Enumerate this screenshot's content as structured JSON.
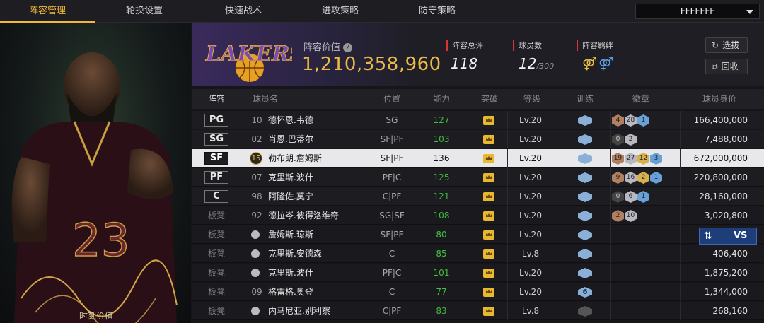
{
  "nav": {
    "tabs": [
      "阵容管理",
      "轮换设置",
      "快速战术",
      "进攻策略",
      "防守策略"
    ],
    "active_tab": 0,
    "select_value": "FFFFFFF"
  },
  "portrait": {
    "caption": "时刻价值"
  },
  "summary": {
    "value_title": "阵容价值",
    "value": "1,210,358,960",
    "stats": [
      {
        "label": "阵容总评",
        "value": "118",
        "suffix": ""
      },
      {
        "label": "球员数",
        "value": "12",
        "suffix": "/300"
      },
      {
        "label": "阵容羁绊",
        "value": "",
        "suffix": ""
      }
    ],
    "scout_button": "选拔",
    "recycle_button": "回收"
  },
  "table": {
    "headers": [
      "阵容",
      "球员名",
      "位置",
      "能力",
      "突破",
      "等级",
      "训练",
      "徽章",
      "球员身价"
    ],
    "rows": [
      {
        "slot": "PG",
        "num": "10",
        "name": "德怀恩.韦德",
        "pos": "SG",
        "ability": "127",
        "level": "Lv.20",
        "train": "",
        "badges": [
          [
            "bronze",
            "4"
          ],
          [
            "silver",
            "28"
          ],
          [
            "blue",
            "1"
          ]
        ],
        "salary": "166,400,000",
        "type": "starter"
      },
      {
        "slot": "SG",
        "num": "02",
        "name": "肖恩.巴蒂尔",
        "pos": "SF|PF",
        "ability": "103",
        "level": "Lv.20",
        "train": "",
        "badges": [
          [
            "dark",
            "0"
          ],
          [
            "silver",
            "2"
          ]
        ],
        "salary": "7,488,000",
        "type": "starter"
      },
      {
        "slot": "SF",
        "num": "15",
        "name": "勒布朗.詹姆斯",
        "pos": "SF|PF",
        "ability": "136",
        "level": "Lv.20",
        "train": "",
        "badges": [
          [
            "bronze",
            "19"
          ],
          [
            "silver",
            "27"
          ],
          [
            "gold",
            "12"
          ],
          [
            "blue",
            "3"
          ]
        ],
        "salary": "672,000,000",
        "type": "selected"
      },
      {
        "slot": "PF",
        "num": "07",
        "name": "克里斯.波什",
        "pos": "PF|C",
        "ability": "125",
        "level": "Lv.20",
        "train": "",
        "badges": [
          [
            "bronze",
            "9"
          ],
          [
            "silver",
            "16"
          ],
          [
            "gold",
            "2"
          ],
          [
            "blue",
            "1"
          ]
        ],
        "salary": "220,800,000",
        "type": "starter"
      },
      {
        "slot": "C",
        "num": "98",
        "name": "阿隆佐.莫宁",
        "pos": "C|PF",
        "ability": "121",
        "level": "Lv.20",
        "train": "",
        "badges": [
          [
            "dark",
            "0"
          ],
          [
            "silver",
            "6"
          ],
          [
            "blue",
            "1"
          ]
        ],
        "salary": "28,160,000",
        "type": "starter"
      },
      {
        "slot": "板凳",
        "num": "92",
        "name": "德拉岑.彼得洛维奇",
        "pos": "SG|SF",
        "ability": "108",
        "level": "Lv.20",
        "train": "",
        "badges": [
          [
            "bronze",
            "2"
          ],
          [
            "silver",
            "10"
          ]
        ],
        "salary": "3,020,800",
        "type": "bench"
      },
      {
        "slot": "板凳",
        "num": "",
        "name": "詹姆斯.琼斯",
        "pos": "SF|PF",
        "ability": "80",
        "level": "Lv.20",
        "train": "",
        "badges": [],
        "salary": "",
        "type": "benchbars"
      },
      {
        "slot": "板凳",
        "num": "",
        "name": "克里斯.安德森",
        "pos": "C",
        "ability": "85",
        "level": "Lv.8",
        "train": "",
        "badges": [],
        "salary": "406,400",
        "type": "benchbars"
      },
      {
        "slot": "板凳",
        "num": "",
        "name": "克里斯.波什",
        "pos": "PF|C",
        "ability": "101",
        "level": "Lv.20",
        "train": "",
        "badges": [],
        "salary": "1,875,200",
        "type": "benchbars"
      },
      {
        "slot": "板凳",
        "num": "09",
        "name": "格雷格.奥登",
        "pos": "C",
        "ability": "77",
        "level": "Lv.20",
        "train": "6",
        "badges": [],
        "salary": "1,344,000",
        "type": "bench"
      },
      {
        "slot": "板凳",
        "num": "",
        "name": "内马尼亚.别利察",
        "pos": "C|PF",
        "ability": "83",
        "level": "Lv.8",
        "train": "",
        "badges": [],
        "salary": "268,160",
        "type": "benchbars_grey"
      }
    ]
  },
  "compare": {
    "label": "VS"
  },
  "colors": {
    "accent": "#f0b838",
    "ability_green": "#3fbf3f",
    "value_gold": "#e8b84a"
  }
}
